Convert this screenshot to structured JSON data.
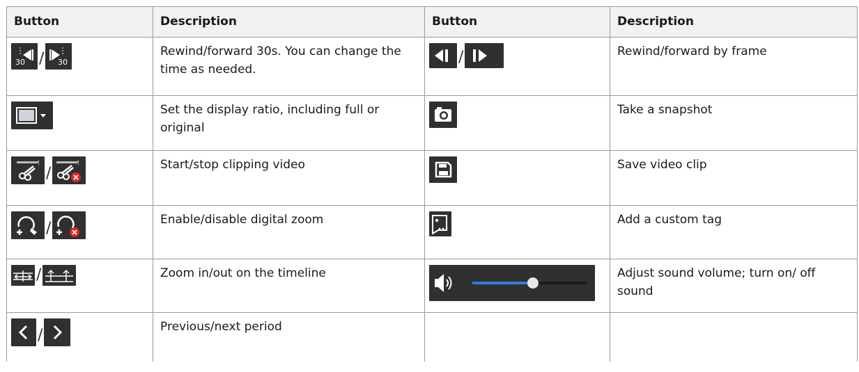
{
  "headers": {
    "button_1": "Button",
    "description_1": "Description",
    "button_2": "Button",
    "description_2": "Description"
  },
  "rows": [
    {
      "left_icons": [
        "rewind-30s-icon",
        "forward-30s-icon"
      ],
      "left_icon_text": [
        "30",
        "30"
      ],
      "left_desc": "Rewind/forward 30s. You can change the time as needed.",
      "right_icons": [
        "frame-back-icon",
        "frame-forward-icon"
      ],
      "right_desc": "Rewind/forward by frame"
    },
    {
      "left_icons": [
        "display-ratio-icon"
      ],
      "left_desc": "Set the display ratio, including full or original",
      "right_icons": [
        "camera-icon"
      ],
      "right_desc": "Take a snapshot"
    },
    {
      "left_icons": [
        "clip-start-icon",
        "clip-stop-icon"
      ],
      "left_desc": "Start/stop clipping video",
      "right_icons": [
        "save-icon"
      ],
      "right_desc": "Save video clip"
    },
    {
      "left_icons": [
        "zoom-enable-icon",
        "zoom-disable-icon"
      ],
      "left_desc": "Enable/disable digital zoom",
      "right_icons": [
        "custom-tag-icon"
      ],
      "right_desc": "Add a custom tag"
    },
    {
      "left_icons": [
        "timeline-zoom-in-icon",
        "timeline-zoom-out-icon"
      ],
      "left_desc": "Zoom in/out on the timeline",
      "right_icons": [
        "volume-slider"
      ],
      "volume_level": 0.53,
      "right_desc": "Adjust sound volume; turn on/ off sound"
    },
    {
      "left_icons": [
        "previous-period-icon",
        "next-period-icon"
      ],
      "left_desc": "Previous/next period",
      "right_icons": [],
      "right_desc": ""
    }
  ],
  "separator": "/",
  "colors": {
    "icon_bg": "#303030",
    "icon_fg": "#ffffff",
    "stop_red": "#e02626",
    "volume_track": "#2a7fd4"
  }
}
